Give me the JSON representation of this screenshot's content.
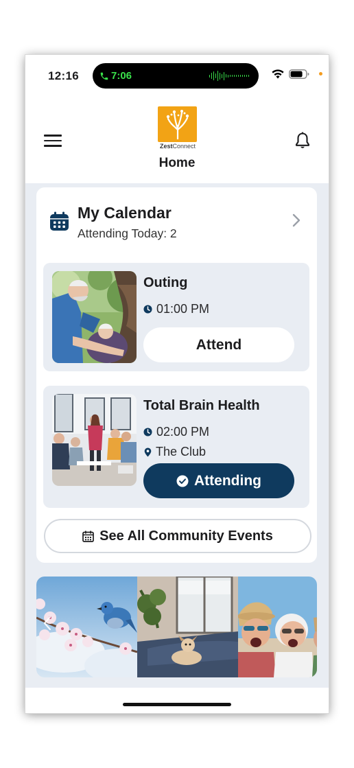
{
  "status_bar": {
    "time": "12:16",
    "call_time": "7:06",
    "accent_call": "#3ae04b"
  },
  "header": {
    "logo_text_bold": "Zest",
    "logo_text_rest": "Connect",
    "title": "Home",
    "menu_icon": "hamburger-icon",
    "bell_icon": "bell-icon"
  },
  "calendar": {
    "title": "My Calendar",
    "subtitle": "Attending Today: 2",
    "icon": "calendar-icon",
    "brand_color": "#0f3a5e"
  },
  "events": [
    {
      "title": "Outing",
      "time": "01:00 PM",
      "location": "",
      "button_label": "Attend",
      "attending": false
    },
    {
      "title": "Total Brain Health",
      "time": "02:00 PM",
      "location": "The Club",
      "button_label": "Attending",
      "attending": true
    }
  ],
  "see_all": {
    "label": "See All Community Events"
  },
  "photo_strip": {
    "tiles": [
      "bluebird-blossom-photo",
      "dog-on-sofa-photo",
      "laughing-seniors-photo"
    ]
  }
}
